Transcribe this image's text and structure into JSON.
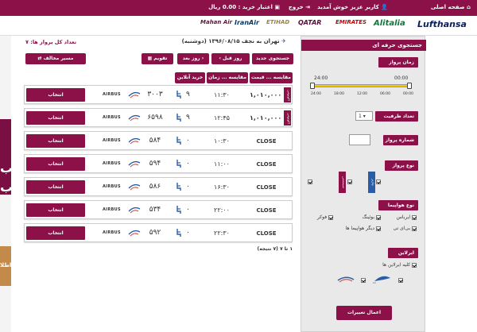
{
  "topbar": {
    "home": "صفحه اصلی",
    "welcome": "کاربر عزیز خوش آمدید",
    "logout": "خروج",
    "credit": "اعتبار خرید : 0.00 ریال"
  },
  "airlines_bar": [
    "Lufthansa",
    "Alitalia",
    "EMIRATES",
    "QATAR",
    "ETIHAD",
    "IranAir",
    "Mahan Air"
  ],
  "left_banner": {
    "glyph": "ب",
    "glyph2": "ب",
    "text": "اطلا"
  },
  "route": {
    "title": "تهران به نجف ۱۳۹۶/۰۸/۱۵ (دوشنبه)",
    "total": "تعداد کل پرواز ها: ۷"
  },
  "toolbar": {
    "new_search": "جستجوی جدید",
    "prev_day": "روز قبل",
    "next_day": "روز بعد",
    "calendar": "تقویم",
    "return_route": "مسیر مخالف"
  },
  "columns": {
    "price": "مقایسه ... قیمت",
    "time": "مقایسه ... زمان",
    "online": "خرید آنلاین"
  },
  "flights": [
    {
      "tag": "اکونومی",
      "price": "۱,۰۱۰,۰۰۰",
      "time": "۱۱:۳۰",
      "seats": "۹",
      "flight_no": "۳۰۰۳",
      "aircraft": "AIRBUS",
      "select": "انتخاب"
    },
    {
      "tag": "اکونومی",
      "price": "۱,۰۱۰,۰۰۰",
      "time": "۱۲:۴۵",
      "seats": "۹",
      "flight_no": "۶۵۹۸",
      "aircraft": "AIRBUS",
      "select": "انتخاب"
    },
    {
      "tag": "",
      "price": "CLOSE",
      "time": "۱۰:۳۰",
      "seats": "۰",
      "flight_no": "۵۸۴",
      "aircraft": "AIRBUS",
      "select": "انتخاب"
    },
    {
      "tag": "",
      "price": "CLOSE",
      "time": "۱۱:۰۰",
      "seats": "۰",
      "flight_no": "۵۹۴",
      "aircraft": "AIRBUS",
      "select": "انتخاب"
    },
    {
      "tag": "",
      "price": "CLOSE",
      "time": "۱۶:۳۰",
      "seats": "۰",
      "flight_no": "۵۸۶",
      "aircraft": "AIRBUS",
      "select": "انتخاب"
    },
    {
      "tag": "",
      "price": "CLOSE",
      "time": "۲۲:۰۰",
      "seats": "۰",
      "flight_no": "۵۳۴",
      "aircraft": "AIRBUS",
      "select": "انتخاب"
    },
    {
      "tag": "",
      "price": "CLOSE",
      "time": "۲۲:۳۰",
      "seats": "۰",
      "flight_no": "۵۹۲",
      "aircraft": "AIRBUS",
      "select": "انتخاب"
    }
  ],
  "pagination": "۱ تا ۷ (۷ نتیجه)",
  "sidebar": {
    "title": "جستجوی حرفه ای",
    "time_section": "زمان پرواز",
    "time_from": "00:00",
    "time_to": "24:00",
    "ticks": [
      "24:00",
      "18:00",
      "12:00",
      "06:00",
      "00:00"
    ],
    "capacity_label": "تعداد ظرفیت",
    "capacity_value": "1",
    "flight_no_label": "شماره پرواز",
    "flight_type_section": "نوع پرواز",
    "type_charter": "سیستمی",
    "type_system": "چارتر",
    "aircraft_section": "نوع هواپیما",
    "aircraft": [
      "ایرباس",
      "بوئینگ",
      "فوکر",
      "بی‌ای تی",
      "دیگر هواپیما ها"
    ],
    "airlines_section": "ایرلاین",
    "all_airlines": "کلیه ایرلاین ها",
    "apply": "اعمال تغییرات"
  }
}
